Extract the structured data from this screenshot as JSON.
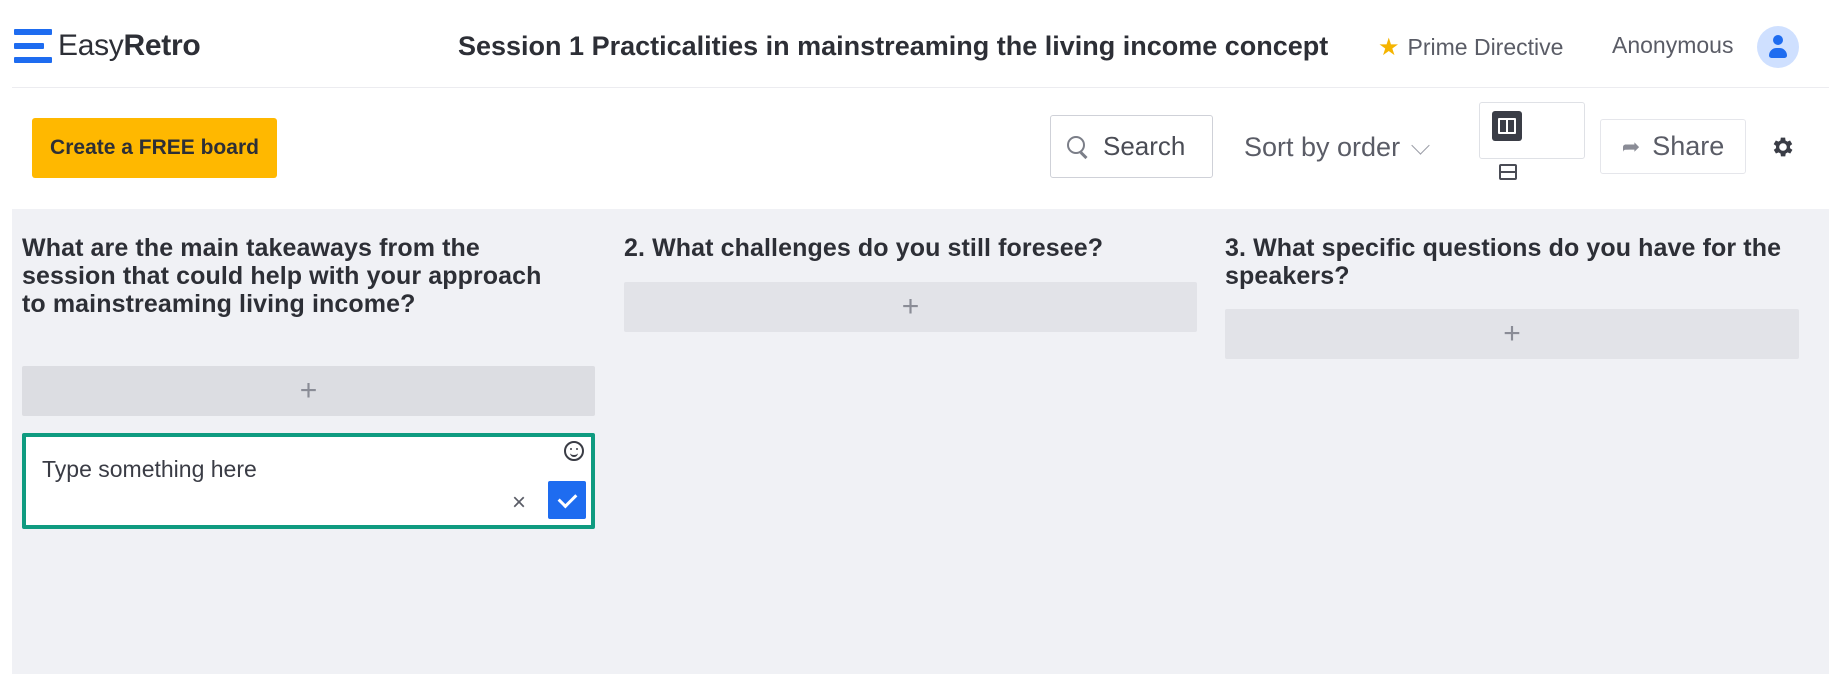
{
  "app": {
    "logo_easy": "Easy",
    "logo_retro": "Retro",
    "board_title": "Session 1 Practicalities in mainstreaming the living income concept",
    "prime_directive": "Prime Directive",
    "user_name": "Anonymous",
    "accent_color": "#1e6cf0",
    "star_color": "#f5b400"
  },
  "toolbar": {
    "create_board_label": "Create a FREE board",
    "create_board_color": "#ffb800",
    "search_label": "Search",
    "sort_label": "Sort by order",
    "share_label": "Share"
  },
  "columns": [
    {
      "title": "What are the main takeaways from the session that could help with your approach to mainstreaming living income?",
      "add_label": "+"
    },
    {
      "title": "2. What challenges do you still foresee?",
      "add_label": "+"
    },
    {
      "title": "3. What specific questions do you have for the speakers?",
      "add_label": "+"
    }
  ],
  "editor": {
    "placeholder": "Type something here",
    "cancel_label": "×",
    "border_color": "#0f9b80"
  }
}
